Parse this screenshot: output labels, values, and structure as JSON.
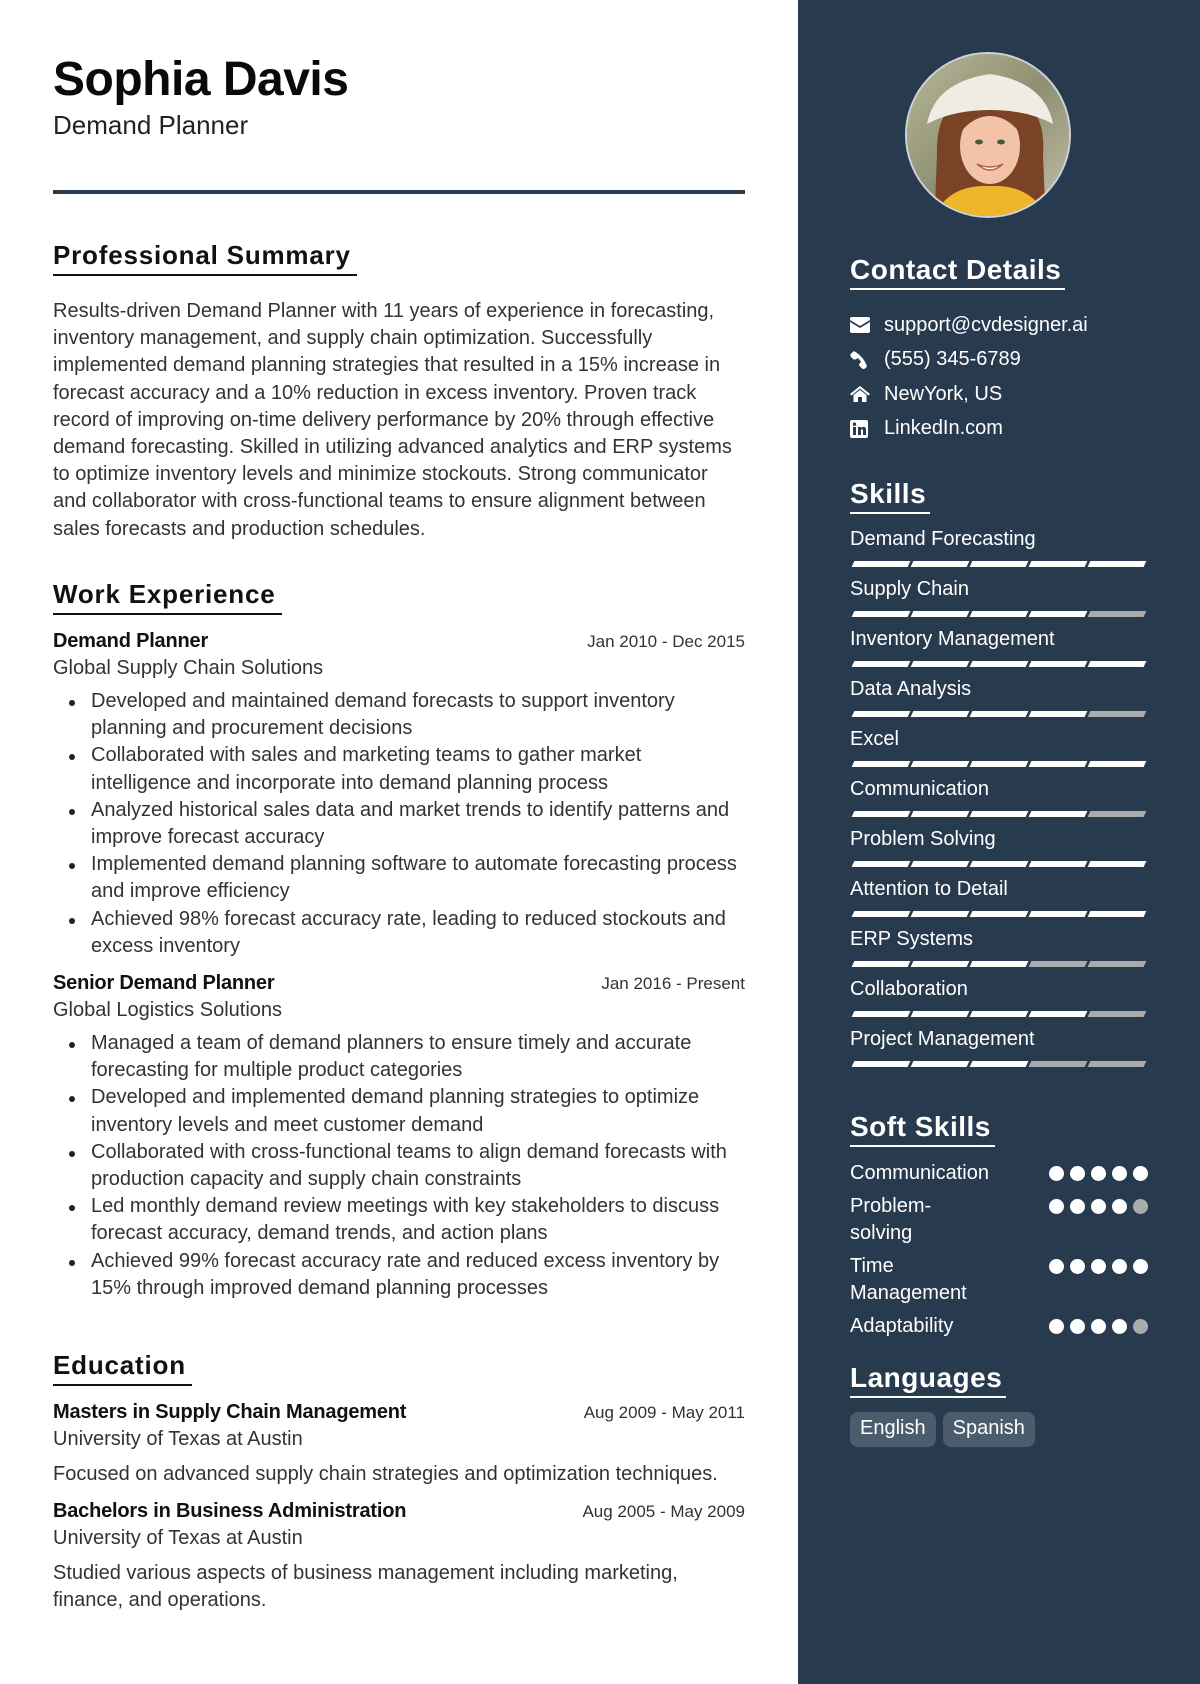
{
  "header": {
    "name": "Sophia Davis",
    "role": "Demand Planner"
  },
  "summary": {
    "title": "Professional Summary",
    "text": "Results-driven Demand Planner with 11 years of experience in forecasting, inventory management, and supply chain optimization. Successfully implemented demand planning strategies that resulted in a 15% increase in forecast accuracy and a 10% reduction in excess inventory. Proven track record of improving on-time delivery performance by 20% through effective demand forecasting. Skilled in utilizing advanced analytics and ERP systems to optimize inventory levels and minimize stockouts. Strong communicator and collaborator with cross-functional teams to ensure alignment between sales forecasts and production schedules."
  },
  "experience": {
    "title": "Work Experience",
    "jobs": [
      {
        "title": "Demand Planner",
        "dates": "Jan 2010 - Dec 2015",
        "company": "Global Supply Chain Solutions",
        "bullets": [
          "Developed and maintained demand forecasts to support inventory planning and procurement decisions",
          "Collaborated with sales and marketing teams to gather market intelligence and incorporate into demand planning process",
          "Analyzed historical sales data and market trends to identify patterns and improve forecast accuracy",
          "Implemented demand planning software to automate forecasting process and improve efficiency",
          "Achieved 98% forecast accuracy rate, leading to reduced stockouts and excess inventory"
        ]
      },
      {
        "title": "Senior Demand Planner",
        "dates": "Jan 2016 - Present",
        "company": "Global Logistics Solutions",
        "bullets": [
          "Managed a team of demand planners to ensure timely and accurate forecasting for multiple product categories",
          "Developed and implemented demand planning strategies to optimize inventory levels and meet customer demand",
          "Collaborated with cross-functional teams to align demand forecasts with production capacity and supply chain constraints",
          "Led monthly demand review meetings with key stakeholders to discuss forecast accuracy, demand trends, and action plans",
          "Achieved 99% forecast accuracy rate and reduced excess inventory by 15% through improved demand planning processes"
        ]
      }
    ]
  },
  "education": {
    "title": "Education",
    "items": [
      {
        "degree": "Masters in Supply Chain Management",
        "dates": "Aug 2009 - May 2011",
        "school": "University of Texas at Austin",
        "description": "Focused on advanced supply chain strategies and optimization techniques."
      },
      {
        "degree": "Bachelors in Business Administration",
        "dates": "Aug 2005 - May 2009",
        "school": "University of Texas at Austin",
        "description": "Studied various aspects of business management including marketing, finance, and operations."
      }
    ]
  },
  "sidebar": {
    "photo_alt": "Profile photo of a smiling woman in a white hat",
    "contact": {
      "title": "Contact Details",
      "items": [
        {
          "icon": "envelope-icon",
          "text": "support@cvdesigner.ai"
        },
        {
          "icon": "phone-icon",
          "text": "(555) 345-6789"
        },
        {
          "icon": "home-icon",
          "text": "NewYork, US"
        },
        {
          "icon": "linkedin-icon",
          "text": "LinkedIn.com"
        }
      ]
    },
    "skills": {
      "title": "Skills",
      "max": 5,
      "items": [
        {
          "name": "Demand Forecasting",
          "level": 5
        },
        {
          "name": "Supply Chain",
          "level": 4
        },
        {
          "name": "Inventory Management",
          "level": 5
        },
        {
          "name": "Data Analysis",
          "level": 4
        },
        {
          "name": "Excel",
          "level": 5
        },
        {
          "name": "Communication",
          "level": 4
        },
        {
          "name": "Problem Solving",
          "level": 5
        },
        {
          "name": "Attention to Detail",
          "level": 5
        },
        {
          "name": "ERP Systems",
          "level": 3
        },
        {
          "name": "Collaboration",
          "level": 4
        },
        {
          "name": "Project Management",
          "level": 3
        }
      ]
    },
    "soft_skills": {
      "title": "Soft Skills",
      "max": 5,
      "items": [
        {
          "name": "Communication",
          "level": 5
        },
        {
          "name": "Problem-solving",
          "level": 4
        },
        {
          "name": "Time Management",
          "level": 5
        },
        {
          "name": "Adaptability",
          "level": 4
        }
      ]
    },
    "languages": {
      "title": "Languages",
      "items": [
        "English",
        "Spanish"
      ]
    }
  },
  "colors": {
    "sidebar_bg": "#273a4e",
    "rule": "#2b3d50",
    "bar_on": "#ffffff",
    "bar_off": "#a9abad",
    "tag_bg": "#4b5c6d"
  }
}
